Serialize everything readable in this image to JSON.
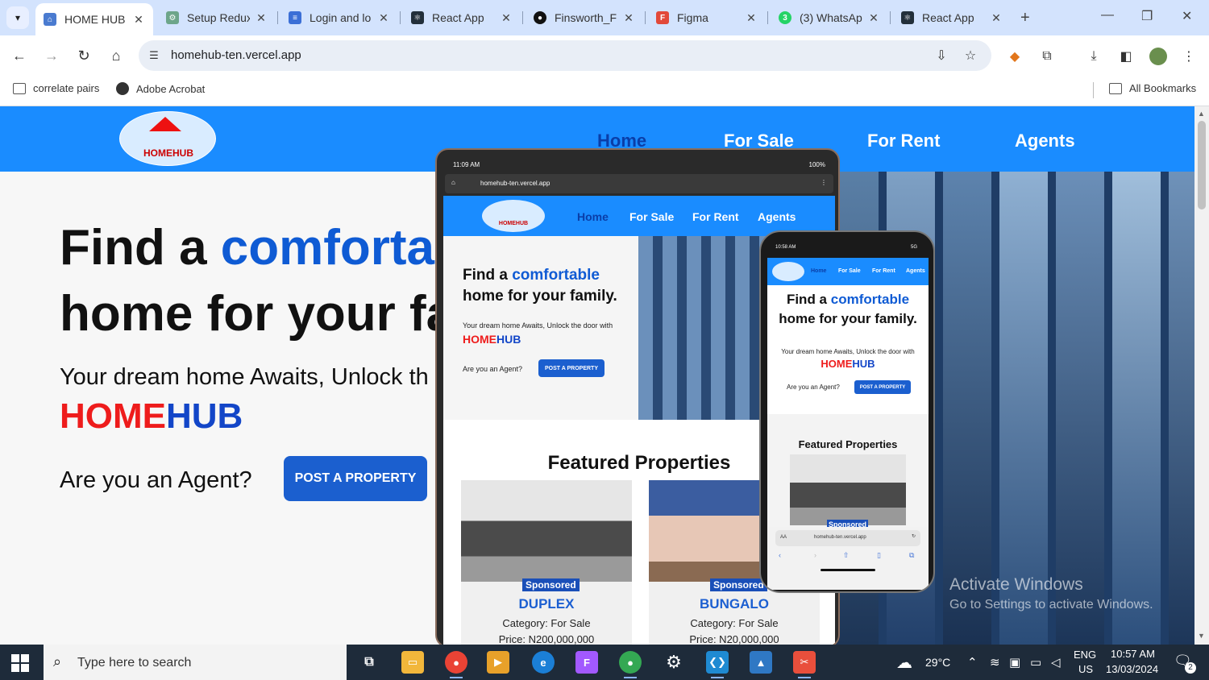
{
  "browser": {
    "tabs": [
      {
        "title": "HOME HUB",
        "favicon_color": "#4a7bd0",
        "active": true
      },
      {
        "title": "Setup Redux",
        "favicon_color": "#6da58a"
      },
      {
        "title": "Login and lo",
        "favicon_color": "#3b6fd6"
      },
      {
        "title": "React App",
        "favicon_color": "#222f3a"
      },
      {
        "title": "Finsworth_F",
        "favicon_color": "#111111"
      },
      {
        "title": "Figma",
        "favicon_color": "#e2493a"
      },
      {
        "title": "(3) WhatsAp",
        "favicon_color": "#25d366",
        "favicon_text": "3"
      },
      {
        "title": "React App",
        "favicon_color": "#222f3a"
      }
    ],
    "url": "homehub-ten.vercel.app",
    "bookmarks": [
      "correlate pairs",
      "Adobe Acrobat"
    ],
    "all_bookmarks": "All Bookmarks"
  },
  "site": {
    "logo_text": "HOMEHUB",
    "nav": [
      "Home",
      "For Sale",
      "For Rent",
      "Agents"
    ],
    "hero": {
      "line1_prefix": "Find a ",
      "line1_accent": "comfortab",
      "line2": "home for your fa",
      "sub": "Your dream home Awaits, Unlock th",
      "brand_part1": "HOME",
      "brand_part2": "HUB",
      "agent_question": "Are you an Agent?",
      "post_button": "POST A PROPERTY"
    }
  },
  "tablet": {
    "status_time": "11:09 AM",
    "status_battery": "100%",
    "url": "homehub-ten.vercel.app",
    "logo_text": "HOMEHUB",
    "nav": [
      "Home",
      "For Sale",
      "For Rent",
      "Agents"
    ],
    "hero_line1_prefix": "Find a ",
    "hero_line1_accent": "comfortable",
    "hero_line2": "home for your family.",
    "sub": "Your dream home Awaits, Unlock the door with",
    "brand_part1": "HOME",
    "brand_part2": "HUB",
    "agent_question": "Are you an Agent?",
    "post_button": "POST A PROPERTY",
    "featured_heading": "Featured Properties",
    "cards": [
      {
        "badge": "Sponsored",
        "title": "DUPLEX",
        "category_label": "Category:",
        "category": "For Sale",
        "price": "Price: N200,000,000"
      },
      {
        "badge": "Sponsored",
        "title": "BUNGALO",
        "category_label": "Category:",
        "category": "For Sale",
        "price": "Price: N20,000,000"
      }
    ]
  },
  "phone": {
    "status_time": "10:58 AM",
    "status_signal": "5G",
    "nav": [
      "Home",
      "For Sale",
      "For Rent",
      "Agents"
    ],
    "hero_line1_prefix": "Find a ",
    "hero_line1_accent": "comfortable",
    "hero_line2": "home for your family.",
    "sub": "Your dream home Awaits, Unlock the door with",
    "brand_part1": "HOME",
    "brand_part2": "HUB",
    "agent_question": "Are you an Agent?",
    "post_button": "POST A PROPERTY",
    "featured_heading": "Featured Properties",
    "badge": "Sponsored",
    "url_aa": "AA",
    "url": "homehub-ten.vercel.app"
  },
  "watermark": {
    "title": "Activate Windows",
    "subtitle": "Go to Settings to activate Windows."
  },
  "taskbar": {
    "search_placeholder": "Type here to search",
    "weather": "29°C",
    "language": "ENG",
    "region": "US",
    "time": "10:57 AM",
    "date": "13/03/2024",
    "notification_count": "2"
  },
  "colors": {
    "site_nav": "#1a8cff",
    "accent_blue": "#0f5bd4",
    "brand_red": "#ee1c1c",
    "brand_blue": "#1346c8",
    "post_button": "#1b5fcf"
  }
}
